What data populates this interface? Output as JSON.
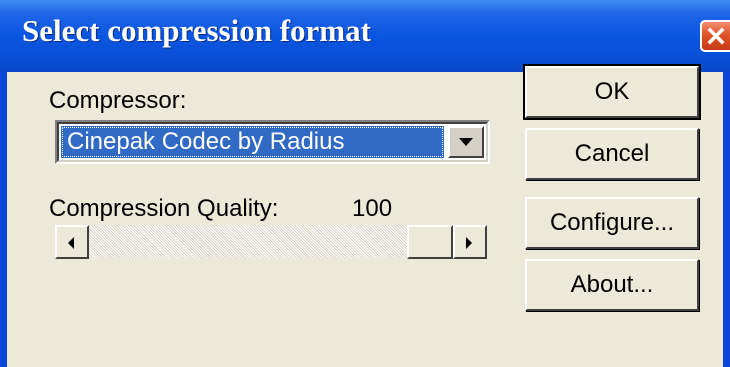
{
  "window": {
    "title": "Select compression format",
    "close_icon": "close-icon",
    "colors": {
      "titlebar": "#0b55e0",
      "dialog_bg": "#ece9d8",
      "selection": "#316ac5",
      "close_button": "#e0552a"
    }
  },
  "compressor": {
    "label": "Compressor:",
    "selected_value": "Cinepak Codec by Radius",
    "dropdown_icon": "chevron-down-icon"
  },
  "quality": {
    "label": "Compression Quality:",
    "value": "100",
    "slider_level": 100
  },
  "buttons": {
    "ok": "OK",
    "cancel": "Cancel",
    "configure": "Configure...",
    "about": "About..."
  }
}
